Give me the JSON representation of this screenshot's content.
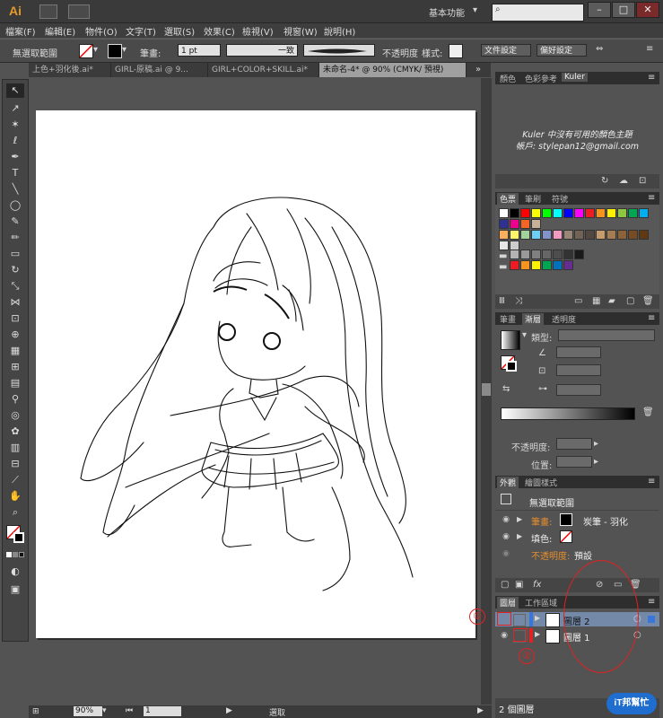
{
  "titlebar": {
    "logo": "Ai",
    "workspace": "基本功能",
    "search_placeholder": "",
    "min": "–",
    "max": "□",
    "close": "✕"
  },
  "menu": [
    "檔案(F)",
    "編輯(E)",
    "物件(O)",
    "文字(T)",
    "選取(S)",
    "效果(C)",
    "檢視(V)",
    "視窗(W)",
    "說明(H)"
  ],
  "control": {
    "selection": "無選取範圍",
    "stroke_label": "筆畫:",
    "stroke_weight": "1 pt",
    "stroke_profile": "一致",
    "opacity_label": "不透明度",
    "style_label": "樣式:",
    "doc_setup": "文件設定",
    "prefs": "偏好設定"
  },
  "tabs": [
    {
      "label": "上色+羽化後.ai*",
      "active": false
    },
    {
      "label": "GIRL-原稿.ai @ 9...",
      "active": false
    },
    {
      "label": "GIRL+COLOR+SKILL.ai*",
      "active": false
    },
    {
      "label": "未命名-4* @ 90% (CMYK/ 預視)",
      "active": true
    }
  ],
  "color_panel": {
    "tabs": [
      "顏色",
      "色彩參考",
      "Kuler"
    ],
    "message_line1": "Kuler 中沒有可用的顏色主題",
    "message_line2": "帳戶: stylepan12@gmail.com"
  },
  "swatches_panel": {
    "tabs": [
      "色票",
      "筆刷",
      "符號"
    ],
    "row1": [
      "#ffffff",
      "#000000",
      "#ff0000",
      "#ffff00",
      "#00ff00",
      "#00ffff",
      "#0000ff",
      "#ff00ff",
      "#ee1d24",
      "#f7941d",
      "#fff200",
      "#8dc63f",
      "#00a651",
      "#00aeef",
      "#2e3192",
      "#ec008c",
      "#f26522",
      "#c7b299"
    ],
    "row2": [
      "#fbaf5d",
      "#fff568",
      "#a3d39c",
      "#6dcff6",
      "#8393ca",
      "#f49ac1",
      "#998675",
      "#736357",
      "#534741",
      "#c69c6d",
      "#a67c52",
      "#8c6239",
      "#754c24",
      "#603913",
      "#e6e6e6",
      "#cccccc"
    ],
    "row3": [
      "#b3b3b3",
      "#999999",
      "#808080",
      "#666666",
      "#4d4d4d",
      "#333333",
      "#1a1a1a"
    ],
    "row4": [
      "#ed1c24",
      "#f7941d",
      "#fff200",
      "#00a651",
      "#0072bc",
      "#662d91"
    ]
  },
  "gradient_panel": {
    "tabs": [
      "筆畫",
      "漸層",
      "透明度"
    ],
    "type_label": "類型:",
    "opacity_label": "不透明度:",
    "position_label": "位置:"
  },
  "appearance_panel": {
    "tabs": [
      "外觀",
      "繪圖樣式"
    ],
    "title": "無選取範圍",
    "stroke_label": "筆畫:",
    "stroke_value": "炭筆 - 羽化",
    "fill_label": "填色:",
    "opacity_label": "不透明度:",
    "opacity_value": "預設",
    "fx": "fx"
  },
  "layers_panel": {
    "tabs": [
      "圖層",
      "工作區域"
    ],
    "layers": [
      {
        "name": "圖層 2"
      },
      {
        "name": "圖層 1"
      }
    ],
    "count": "2 個圖層",
    "annotations": [
      "①",
      "②"
    ]
  },
  "status": {
    "zoom": "90%",
    "page": "1",
    "tool": "選取"
  },
  "watermark": "iT邦幫忙"
}
